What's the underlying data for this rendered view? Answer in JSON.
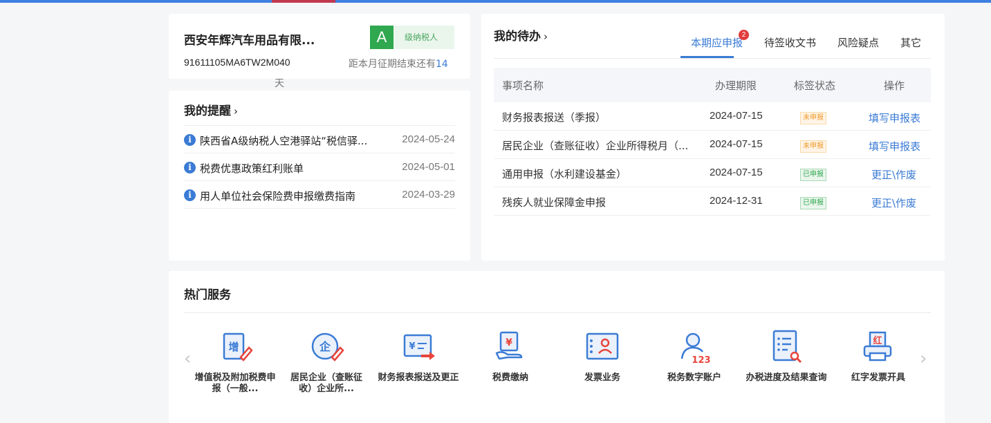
{
  "company": {
    "name": "西安年辉汽车用品有限...",
    "grade_letter": "A",
    "grade_label": "级纳税人",
    "tax_id": "91611105MA6TW2M040",
    "deadline_text": "距本月征期结束还有",
    "deadline_days": "14",
    "deadline_unit": "天"
  },
  "reminder": {
    "title": "我的提醒",
    "chevron": "›",
    "items": [
      {
        "icon": "info-icon",
        "title": "陕西省A级纳税人空港驿站“税信驿...",
        "date": "2024-05-24"
      },
      {
        "icon": "info-icon",
        "title": "税费优惠政策红利账单",
        "date": "2024-05-01"
      },
      {
        "icon": "info-icon",
        "title": "用人单位社会保险费申报缴费指南",
        "date": "2024-03-29"
      }
    ]
  },
  "todo": {
    "title": "我的待办",
    "chevron": "›",
    "tabs": [
      {
        "label": "本期应申报",
        "badge": "2",
        "active": true
      },
      {
        "label": "待签收文书"
      },
      {
        "label": "风险疑点"
      },
      {
        "label": "其它"
      }
    ],
    "columns": [
      "事项名称",
      "办理期限",
      "标签状态",
      "操作"
    ],
    "rows": [
      {
        "name": "财务报表报送（季报）",
        "deadline": "2024-07-15",
        "status": "未申报",
        "status_type": "pending",
        "action": "填写申报表"
      },
      {
        "name": "居民企业（查账征收）企业所得税月（...",
        "deadline": "2024-07-15",
        "status": "未申报",
        "status_type": "pending",
        "action": "填写申报表"
      },
      {
        "name": "通用申报（水利建设基金）",
        "deadline": "2024-07-15",
        "status": "已申报",
        "status_type": "done",
        "action": "更正\\作废"
      },
      {
        "name": "残疾人就业保障金申报",
        "deadline": "2024-12-31",
        "status": "已申报",
        "status_type": "done",
        "action": "更正\\作废"
      }
    ]
  },
  "hot": {
    "title": "热门服务",
    "prev_icon": "chevron-left-icon",
    "next_icon": "chevron-right-icon",
    "prev_glyph": "‹",
    "next_glyph": "›",
    "services": [
      {
        "icon": "vat-declaration-icon",
        "glyph": "增",
        "label": "增值税及附加税费申报（一般..."
      },
      {
        "icon": "enterprise-tax-icon",
        "glyph": "企",
        "label": "居民企业（查账征收）企业所..."
      },
      {
        "icon": "financial-report-icon",
        "glyph": "¥",
        "label": "财务报表报送及更正"
      },
      {
        "icon": "tax-payment-icon",
        "glyph": "¥",
        "label": "税费缴纳"
      },
      {
        "icon": "invoice-business-icon",
        "label": "发票业务"
      },
      {
        "icon": "digital-account-icon",
        "glyph": "123",
        "label": "税务数字账户"
      },
      {
        "icon": "progress-query-icon",
        "label": "办税进度及结果查询"
      },
      {
        "icon": "red-invoice-icon",
        "glyph": "红",
        "label": "红字发票开具"
      }
    ]
  },
  "colors": {
    "accent": "#3a7bd5",
    "grade_green": "#2fa84f",
    "pending_orange": "#f09a2c",
    "badge_red": "#e23b3b",
    "icon_red": "#e8443c"
  }
}
